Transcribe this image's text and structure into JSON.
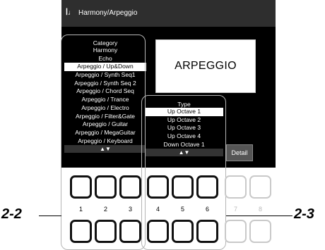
{
  "window": {
    "title": "Harmony/Arpeggio",
    "icon": "music-score-icon"
  },
  "preview": {
    "label": "ARPEGGIO"
  },
  "detail_button": {
    "label": "Detail"
  },
  "category_list": {
    "header": "Category",
    "items": [
      "Harmony",
      "Echo",
      "Arpeggio / Up&Down",
      "Arpeggio / Synth Seq1",
      "Arpeggio / Synth Seq 2",
      "Arpeggio / Chord Seq",
      "Arpeggio / Trance",
      "Arpeggio / Electro",
      "Arpeggio / Filter&Gate",
      "Arpeggio / Guitar",
      "Arpeggio / MegaGuitar",
      "Arpeggio / Keyboard"
    ],
    "selected": "Arpeggio / Up&Down",
    "scroll_arrows": "▲▼"
  },
  "type_list": {
    "header": "Type",
    "items": [
      "Up Octave 1",
      "Up Octave 2",
      "Up Octave 3",
      "Up Octave 4",
      "Down Octave 1"
    ],
    "selected": "Up Octave 1",
    "scroll_arrows": "▲▼"
  },
  "buttons": {
    "numbers": [
      "1",
      "2",
      "3",
      "4",
      "5",
      "6",
      "7",
      "8"
    ]
  },
  "callouts": {
    "left": "2-2",
    "right": "2-3"
  }
}
